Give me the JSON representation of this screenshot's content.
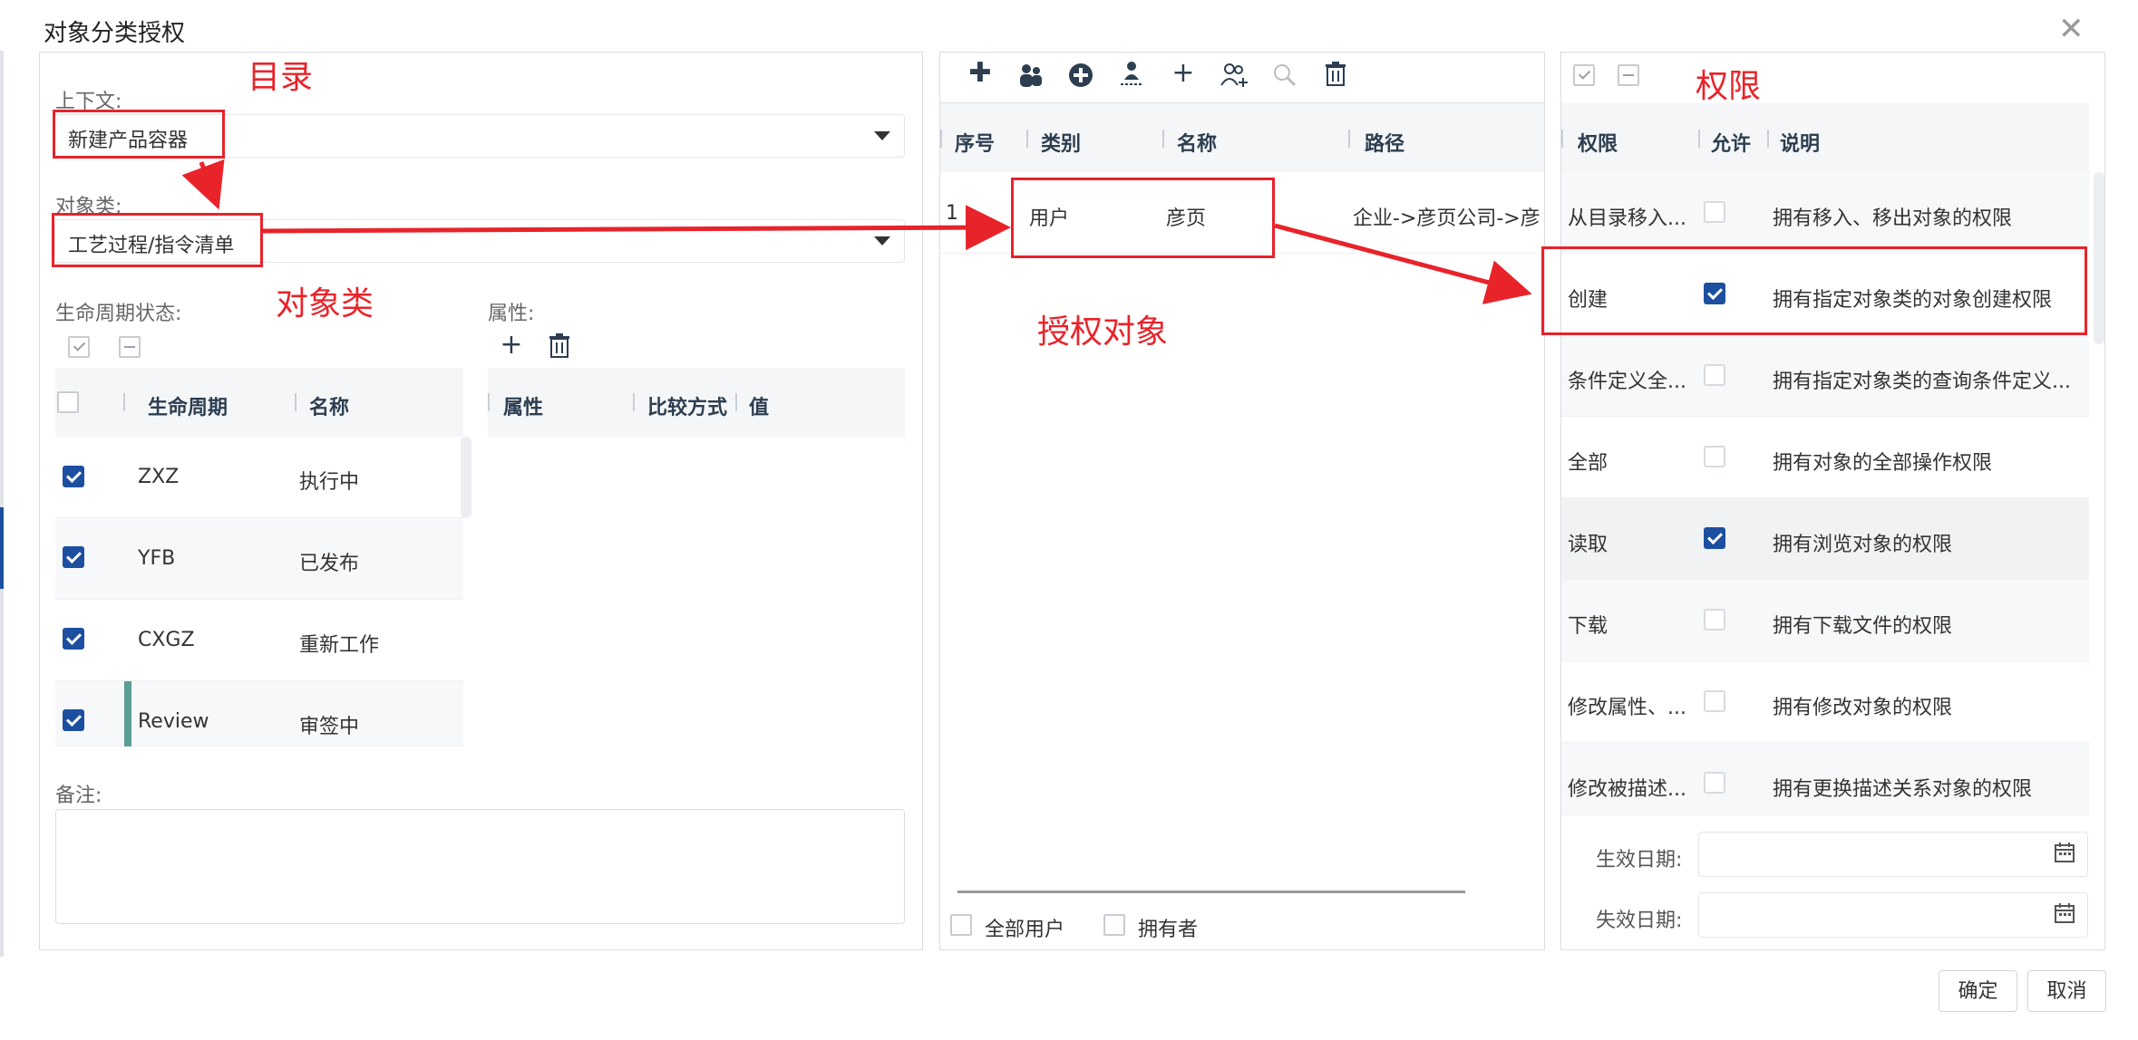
{
  "dialog": {
    "title": "对象分类授权",
    "close_glyph": "✕",
    "ok_label": "确定",
    "cancel_label": "取消"
  },
  "annotations": {
    "catalog": "目录",
    "object_class": "对象类",
    "auth_object": "授权对象",
    "permission": "权限"
  },
  "left": {
    "context_label": "上下文:",
    "context_value": "新建产品容器",
    "class_label": "对象类:",
    "class_value": "工艺过程/指令清单",
    "lifecycle_label": "生命周期状态:",
    "lifecycle_headers": {
      "lifecycle": "生命周期",
      "name": "名称"
    },
    "lifecycle_rows": [
      {
        "code": "ZXZ",
        "name": "执行中",
        "checked": true
      },
      {
        "code": "YFB",
        "name": "已发布",
        "checked": true
      },
      {
        "code": "CXGZ",
        "name": "重新工作",
        "checked": true
      },
      {
        "code": "Review",
        "name": "审签中",
        "checked": true
      }
    ],
    "attr_label": "属性:",
    "attr_headers": {
      "attr": "属性",
      "compare": "比较方式",
      "value": "值"
    },
    "remark_label": "备注:"
  },
  "middle": {
    "headers": {
      "index": "序号",
      "type": "类别",
      "name": "名称",
      "path": "路径"
    },
    "rows": [
      {
        "index": "1",
        "type": "用户",
        "name": "彦页",
        "path": "企业->彦页公司->彦"
      }
    ],
    "all_users_label": "全部用户",
    "owner_label": "拥有者"
  },
  "right": {
    "headers": {
      "perm": "权限",
      "allow": "允许",
      "desc": "说明"
    },
    "rows": [
      {
        "perm": "从目录移入...",
        "allow": false,
        "desc": "拥有移入、移出对象的权限"
      },
      {
        "perm": "创建",
        "allow": true,
        "desc": "拥有指定对象类的对象创建权限"
      },
      {
        "perm": "条件定义全...",
        "allow": false,
        "desc": "拥有指定对象类的查询条件定义..."
      },
      {
        "perm": "全部",
        "allow": false,
        "desc": "拥有对象的全部操作权限"
      },
      {
        "perm": "读取",
        "allow": true,
        "desc": "拥有浏览对象的权限"
      },
      {
        "perm": "下载",
        "allow": false,
        "desc": "拥有下载文件的权限"
      },
      {
        "perm": "修改属性、...",
        "allow": false,
        "desc": "拥有修改对象的权限"
      },
      {
        "perm": "修改被描述...",
        "allow": false,
        "desc": "拥有更换描述关系对象的权限"
      }
    ],
    "effective_label": "生效日期:",
    "expire_label": "失效日期:"
  },
  "colors": {
    "accent": "#1d4fa0",
    "annotation": "#e8232a",
    "review_bar": "#5b9e96"
  }
}
